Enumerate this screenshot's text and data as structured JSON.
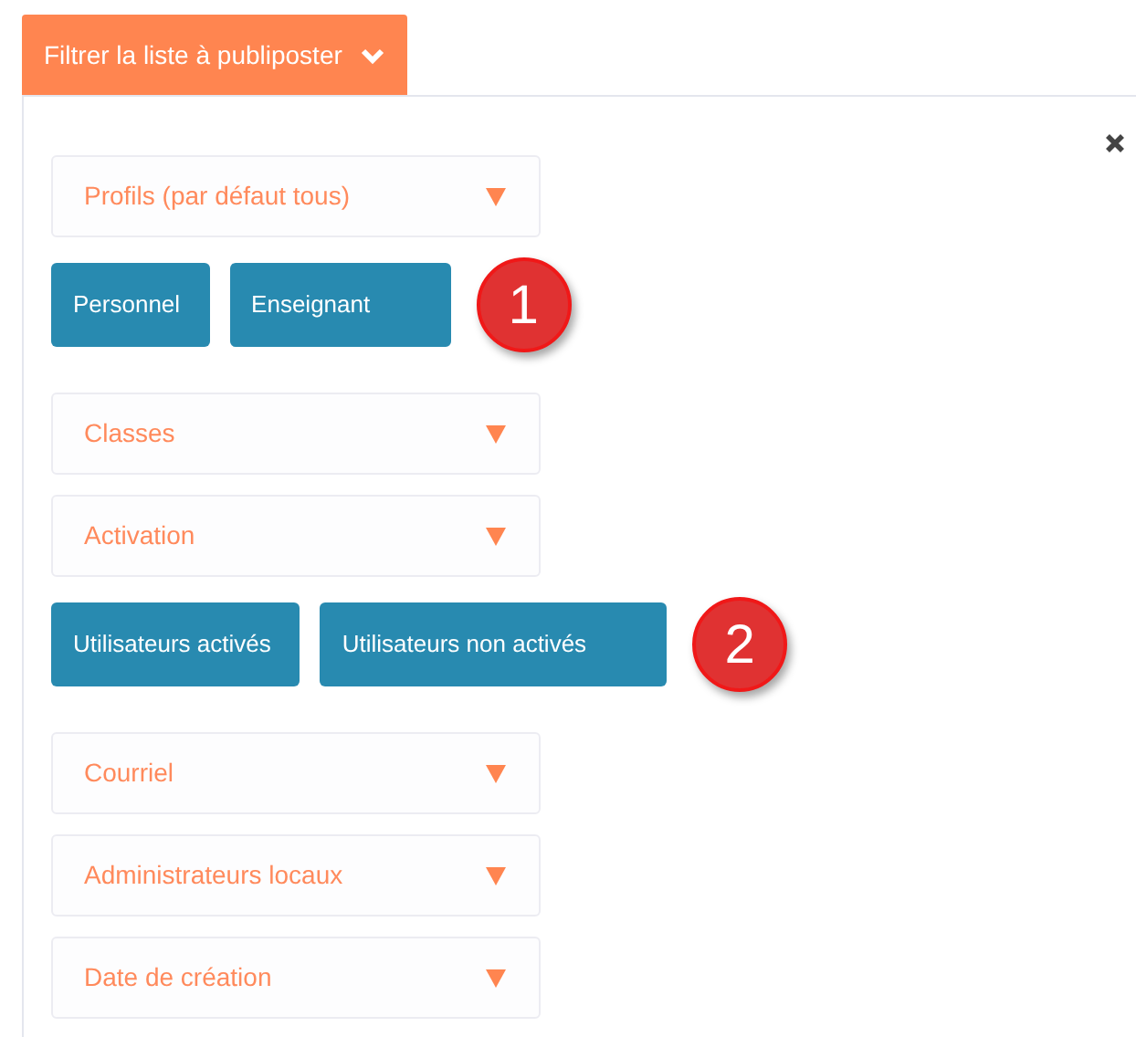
{
  "filter_toggle": {
    "label": "Filtrer la liste à publiposter",
    "expanded": true
  },
  "filters": [
    {
      "kind": "dropdown",
      "label": "Profils (par défaut tous)"
    },
    {
      "kind": "buttons",
      "buttons": [
        "Personnel",
        "Enseignant"
      ],
      "callout": "1"
    },
    {
      "kind": "dropdown",
      "label": "Classes"
    },
    {
      "kind": "dropdown",
      "label": "Activation"
    },
    {
      "kind": "buttons",
      "buttons": [
        "Utilisateurs activés",
        "Utilisateurs non activés"
      ],
      "callout": "2"
    },
    {
      "kind": "dropdown",
      "label": "Courriel"
    },
    {
      "kind": "dropdown",
      "label": "Administrateurs locaux"
    },
    {
      "kind": "dropdown",
      "label": "Date de création"
    }
  ]
}
